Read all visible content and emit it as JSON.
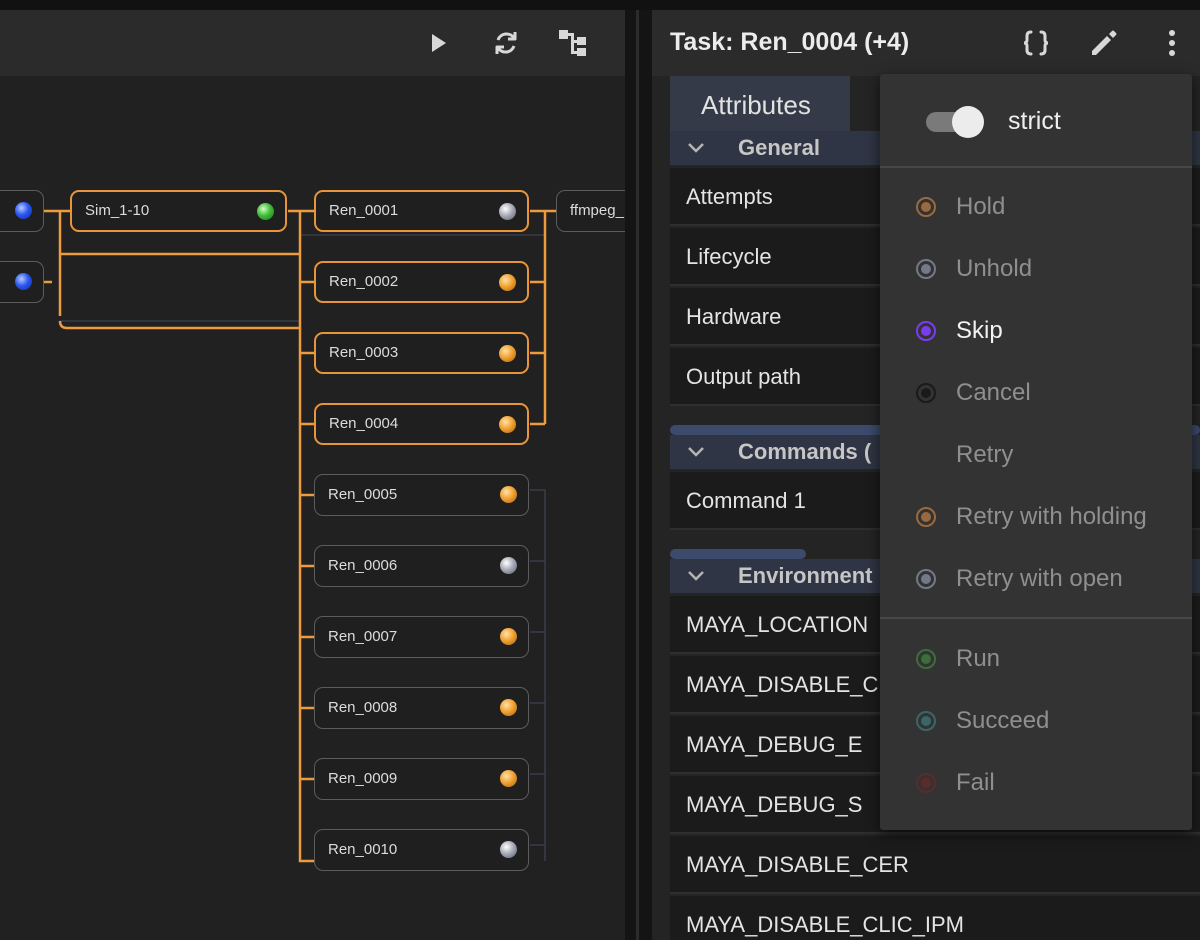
{
  "graph": {
    "nodes": {
      "sim": "Sim_1-10",
      "ren": [
        "Ren_0001",
        "Ren_0002",
        "Ren_0003",
        "Ren_0004",
        "Ren_0005",
        "Ren_0006",
        "Ren_0007",
        "Ren_0008",
        "Ren_0009",
        "Ren_0010"
      ],
      "ren_status": [
        "gray",
        "orange",
        "orange",
        "orange",
        "orange",
        "gray",
        "orange",
        "orange",
        "orange",
        "gray"
      ],
      "ffmpeg": "ffmpeg_"
    },
    "toolbar_icons": [
      "play-icon",
      "refresh-icon",
      "tree-layout-icon"
    ]
  },
  "panel": {
    "title": "Task: Ren_0004 (+4)",
    "header_icons": [
      "braces-icon",
      "edit-icon",
      "more-vert-icon"
    ],
    "tab": "Attributes",
    "sections": {
      "general": {
        "title": "General",
        "rows": [
          "Attempts",
          "Lifecycle",
          "Hardware",
          "Output path"
        ]
      },
      "commands": {
        "title": "Commands (",
        "rows": [
          "Command 1"
        ]
      },
      "environment": {
        "title": "Environment",
        "rows": [
          "MAYA_LOCATION",
          "MAYA_DISABLE_C",
          "MAYA_DEBUG_E",
          "MAYA_DEBUG_S",
          "MAYA_DISABLE_CER",
          "MAYA_DISABLE_CLIC_IPM"
        ]
      }
    }
  },
  "menu": {
    "toggle_label": "strict",
    "toggle_on": true,
    "items_group1": [
      {
        "label": "Hold",
        "color": "#9a6a3e"
      },
      {
        "label": "Unhold",
        "color": "#737987"
      },
      {
        "label": "Skip",
        "color": "#7b3cf0",
        "active": true
      },
      {
        "label": "Cancel",
        "color": "#1a1a1a"
      },
      {
        "label": "Retry",
        "color": ""
      },
      {
        "label": "Retry with holding",
        "color": "#9a6a3e"
      },
      {
        "label": "Retry with open",
        "color": "#737987"
      }
    ],
    "items_group2": [
      {
        "label": "Run",
        "color": "#3c6e3a"
      },
      {
        "label": "Succeed",
        "color": "#3a6668"
      },
      {
        "label": "Fail",
        "color": "#5e2a2a"
      }
    ]
  }
}
